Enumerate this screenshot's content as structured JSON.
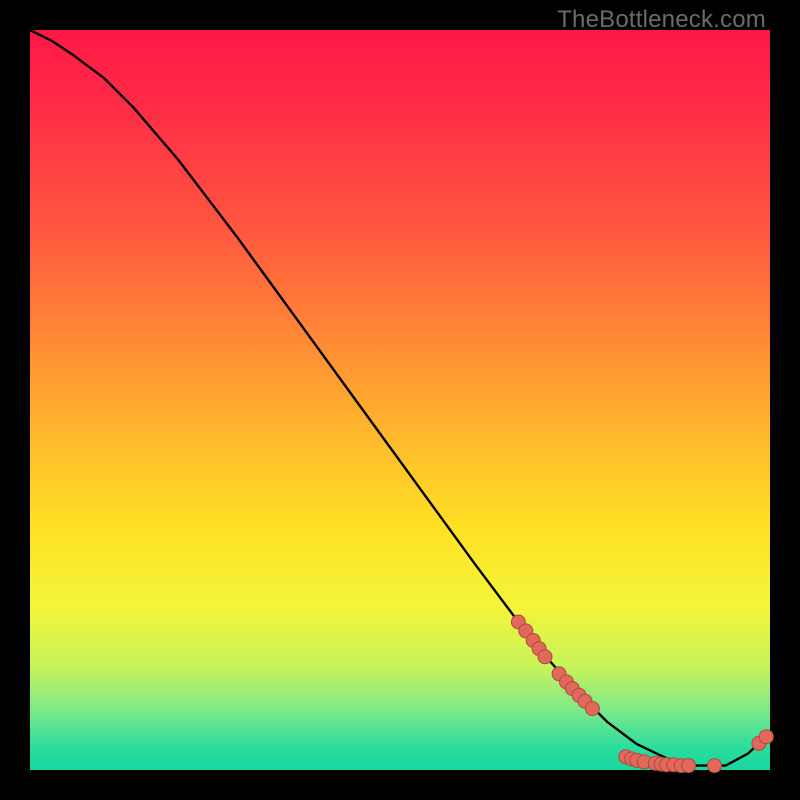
{
  "watermark": "TheBottleneck.com",
  "colors": {
    "background": "#000000",
    "curve": "#000000",
    "dot_fill": "#e0695c",
    "dot_stroke": "#b04a40",
    "gradient_top": "#ff1846",
    "gradient_bottom": "#18d6a0"
  },
  "chart_data": {
    "type": "line",
    "title": "",
    "xlabel": "",
    "ylabel": "",
    "xlim": [
      0,
      100
    ],
    "ylim": [
      0,
      100
    ],
    "grid": false,
    "legend": false,
    "series": [
      {
        "name": "bottleneck-curve",
        "x": [
          0,
          3,
          6,
          10,
          14,
          20,
          28,
          36,
          44,
          52,
          60,
          66,
          70,
          74,
          78,
          82,
          86,
          90,
          94,
          97,
          100
        ],
        "y": [
          100,
          98.5,
          96.5,
          93.5,
          89.5,
          82.5,
          72,
          61,
          50,
          39,
          28,
          20,
          15,
          10.5,
          6.5,
          3.5,
          1.6,
          0.6,
          0.6,
          2.2,
          5
        ]
      }
    ],
    "points": [
      {
        "name": "p1",
        "x": 66.0,
        "y": 20.0
      },
      {
        "name": "p2",
        "x": 67.0,
        "y": 18.8
      },
      {
        "name": "p3",
        "x": 68.0,
        "y": 17.5
      },
      {
        "name": "p4",
        "x": 68.8,
        "y": 16.4
      },
      {
        "name": "p5",
        "x": 69.6,
        "y": 15.3
      },
      {
        "name": "p6",
        "x": 71.5,
        "y": 13.0
      },
      {
        "name": "p7",
        "x": 72.5,
        "y": 11.9
      },
      {
        "name": "p8",
        "x": 73.3,
        "y": 11.0
      },
      {
        "name": "p9",
        "x": 74.2,
        "y": 10.1
      },
      {
        "name": "p10",
        "x": 75.0,
        "y": 9.3
      },
      {
        "name": "p11",
        "x": 76.0,
        "y": 8.3
      },
      {
        "name": "p12",
        "x": 80.5,
        "y": 1.8
      },
      {
        "name": "p13",
        "x": 81.3,
        "y": 1.5
      },
      {
        "name": "p14",
        "x": 82.0,
        "y": 1.3
      },
      {
        "name": "p15",
        "x": 83.0,
        "y": 1.1
      },
      {
        "name": "p16",
        "x": 84.5,
        "y": 0.9
      },
      {
        "name": "p17",
        "x": 85.3,
        "y": 0.8
      },
      {
        "name": "p18",
        "x": 86.0,
        "y": 0.7
      },
      {
        "name": "p19",
        "x": 87.0,
        "y": 0.7
      },
      {
        "name": "p20",
        "x": 88.0,
        "y": 0.6
      },
      {
        "name": "p21",
        "x": 89.0,
        "y": 0.6
      },
      {
        "name": "p22",
        "x": 92.5,
        "y": 0.6
      },
      {
        "name": "p23",
        "x": 98.5,
        "y": 3.6
      },
      {
        "name": "p24",
        "x": 99.5,
        "y": 4.5
      }
    ]
  }
}
